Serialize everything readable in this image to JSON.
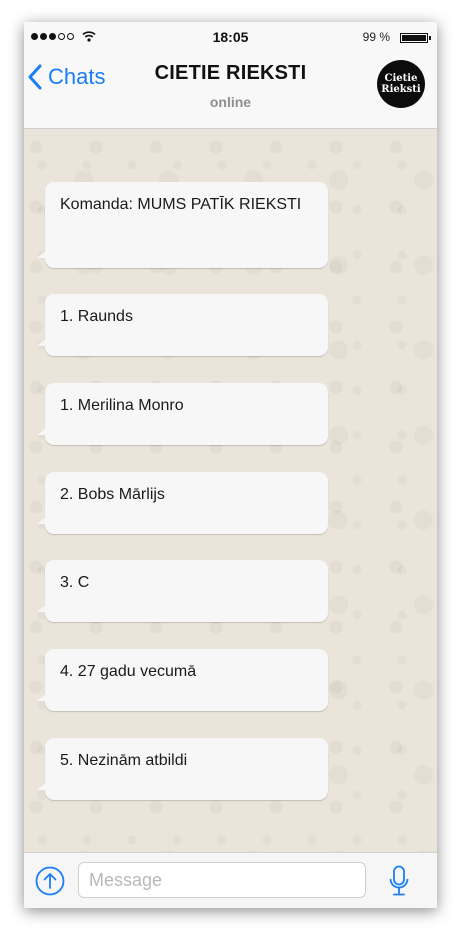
{
  "status_bar": {
    "time": "18:05",
    "battery_percent_text": "99 %",
    "battery_level": 0.99,
    "signal_dots_filled": 3,
    "signal_dots_total": 5,
    "icons": [
      "signal-dots-icon",
      "wifi-icon",
      "battery-icon"
    ]
  },
  "header": {
    "back_label": "Chats",
    "title": "CIETIE RIEKSTI",
    "subtitle": "online",
    "avatar_text": "Cietie\nRieksti"
  },
  "messages": [
    {
      "text": "Komanda: MUMS PATĪK RIEKSTI"
    },
    {
      "text": "1. Raunds"
    },
    {
      "text": "1. Merilina Monro"
    },
    {
      "text": "2. Bobs Mārlijs"
    },
    {
      "text": "3. C"
    },
    {
      "text": "4. 27 gadu vecumā"
    },
    {
      "text": "5. Nezinām atbildi"
    }
  ],
  "input_bar": {
    "placeholder": "Message",
    "value": "",
    "icons": [
      "upload-icon",
      "microphone-icon"
    ]
  },
  "colors": {
    "accent": "#1a7ef5",
    "chat_background": "#ebe4da",
    "bubble": "#f7f7f7"
  }
}
